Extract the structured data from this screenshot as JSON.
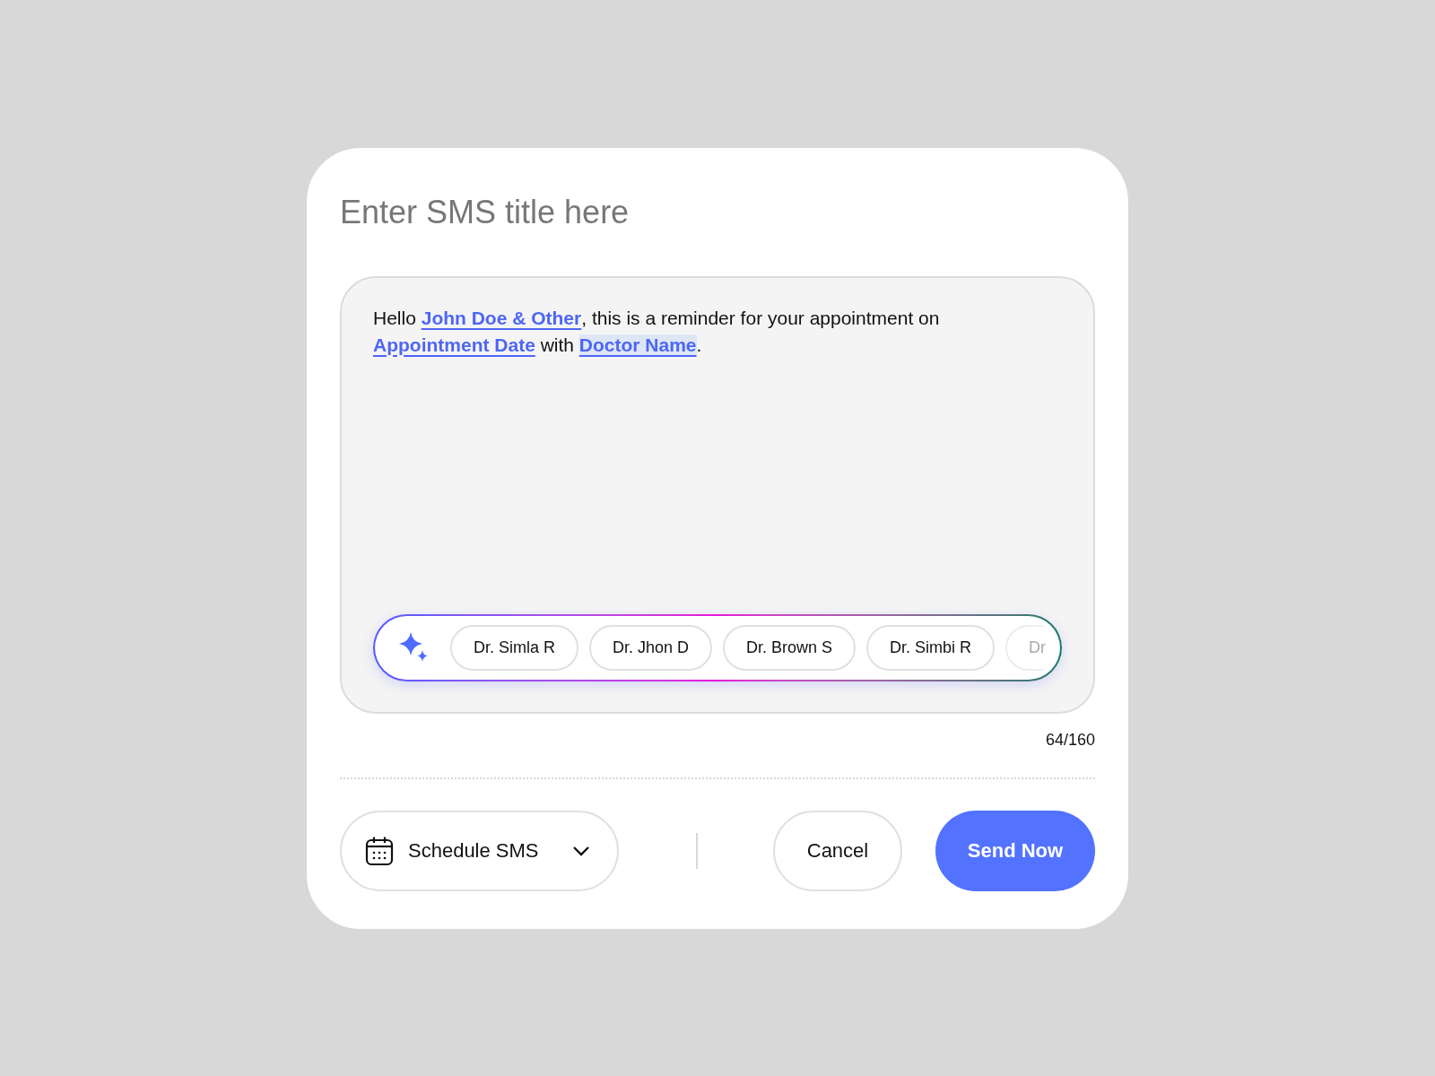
{
  "title_field": {
    "placeholder": "Enter SMS title here"
  },
  "message": {
    "parts": [
      {
        "kind": "text",
        "text": "Hello "
      },
      {
        "kind": "tag",
        "text": "John Doe & Other",
        "highlighted": false
      },
      {
        "kind": "text",
        "text": ", this is a reminder for your appointment on "
      },
      {
        "kind": "tag",
        "text": "Appointment Date",
        "highlighted": false
      },
      {
        "kind": "text",
        "text": " with "
      },
      {
        "kind": "tag",
        "text": "Doctor Name",
        "highlighted": true
      },
      {
        "kind": "text",
        "text": "."
      }
    ]
  },
  "suggestions": [
    {
      "label": "Dr. Simla R",
      "faded": false
    },
    {
      "label": "Dr. Jhon D",
      "faded": false
    },
    {
      "label": "Dr. Brown S",
      "faded": false
    },
    {
      "label": "Dr. Simbi R",
      "faded": false
    },
    {
      "label": "Dr",
      "faded": true
    }
  ],
  "counter": "64/160",
  "schedule": {
    "label": "Schedule SMS"
  },
  "buttons": [
    {
      "kind": "secondary",
      "label": "Cancel"
    },
    {
      "kind": "primary",
      "label": "Send Now"
    }
  ]
}
